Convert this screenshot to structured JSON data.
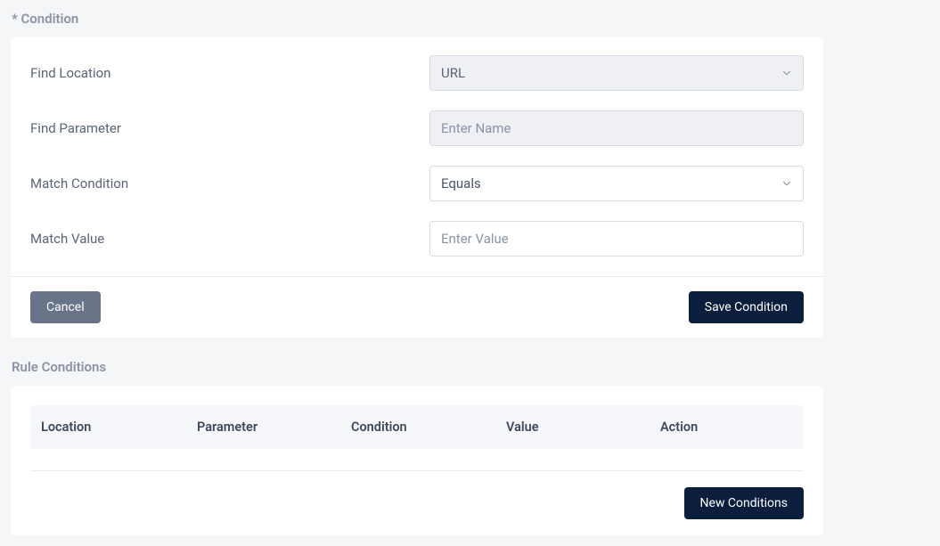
{
  "condition_form": {
    "title": "* Condition",
    "fields": {
      "find_location": {
        "label": "Find Location",
        "value": "URL"
      },
      "find_parameter": {
        "label": "Find Parameter",
        "placeholder": "Enter Name",
        "value": ""
      },
      "match_condition": {
        "label": "Match Condition",
        "value": "Equals"
      },
      "match_value": {
        "label": "Match Value",
        "placeholder": "Enter Value",
        "value": ""
      }
    },
    "actions": {
      "cancel": "Cancel",
      "save": "Save Condition"
    }
  },
  "rule_conditions": {
    "title": "Rule Conditions",
    "columns": {
      "location": "Location",
      "parameter": "Parameter",
      "condition": "Condition",
      "value": "Value",
      "action": "Action"
    },
    "rows": [],
    "actions": {
      "new": "New Conditions"
    }
  }
}
